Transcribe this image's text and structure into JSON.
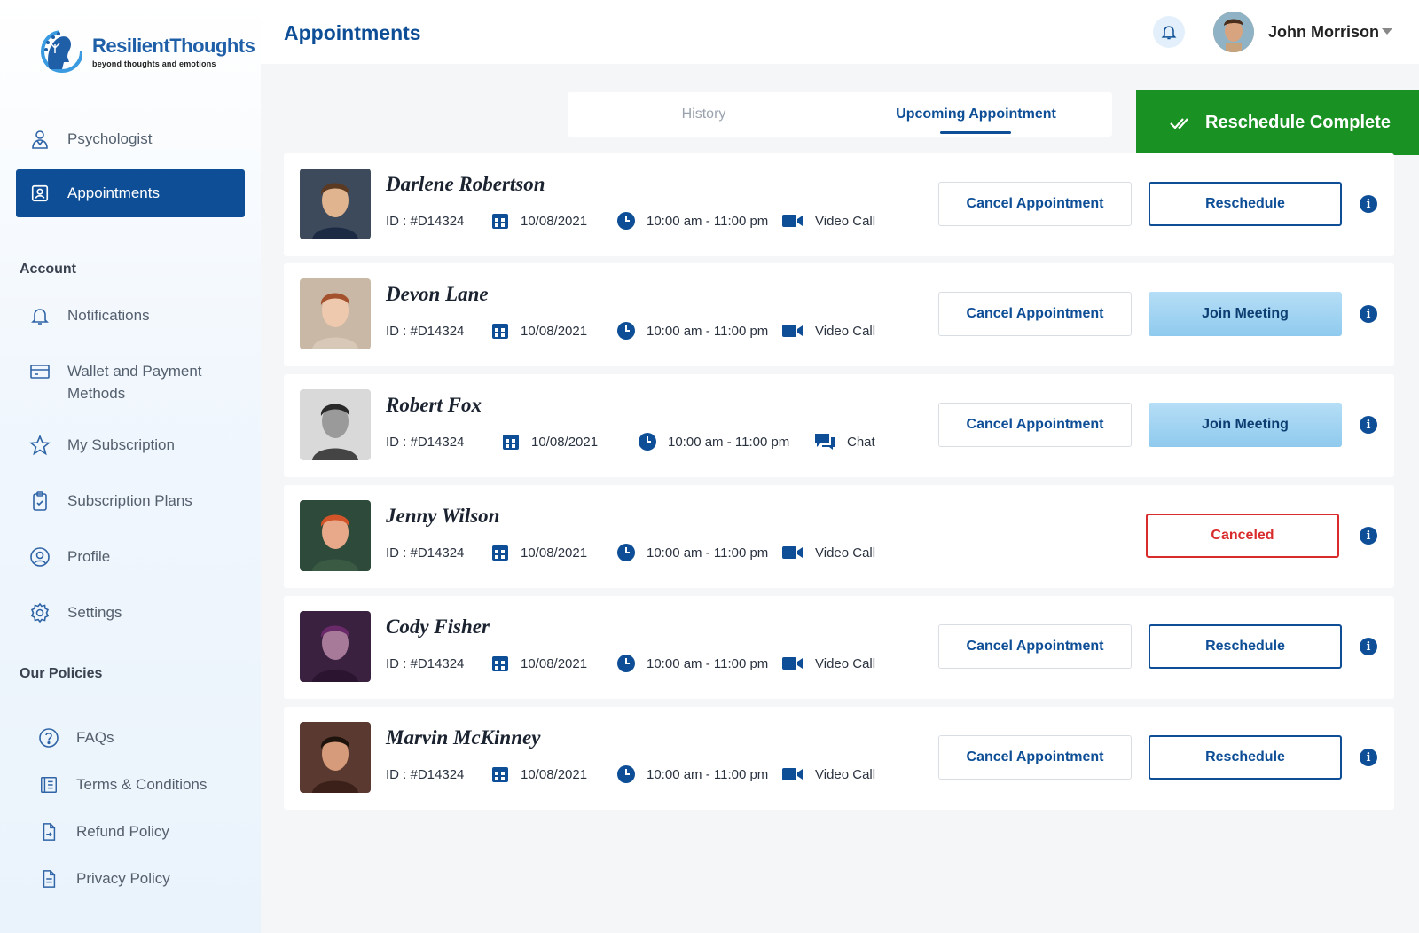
{
  "brand": {
    "name_part1": "Resilient",
    "name_part2": "Thoughts",
    "tagline": "beyond thoughts and emotions"
  },
  "sidebar": {
    "items": [
      {
        "label": "Psychologist",
        "icon": "psychologist-icon",
        "active": false
      },
      {
        "label": "Appointments",
        "icon": "appointments-icon",
        "active": true
      }
    ],
    "account_label": "Account",
    "account_items": [
      {
        "label": "Notifications",
        "icon": "bell-icon"
      },
      {
        "label": "Wallet and Payment Methods",
        "icon": "wallet-icon"
      },
      {
        "label": "My Subscription",
        "icon": "star-icon"
      },
      {
        "label": "Subscription Plans",
        "icon": "clipboard-icon"
      },
      {
        "label": "Profile",
        "icon": "profile-icon"
      },
      {
        "label": "Settings",
        "icon": "gear-icon"
      }
    ],
    "policies_label": "Our Policies",
    "policy_items": [
      {
        "label": "FAQs",
        "icon": "question-icon"
      },
      {
        "label": "Terms & Conditions",
        "icon": "document-icon"
      },
      {
        "label": "Refund Policy",
        "icon": "refund-icon"
      },
      {
        "label": "Privacy Policy",
        "icon": "file-icon"
      }
    ]
  },
  "header": {
    "title": "Appointments",
    "user_name": "John Morrison"
  },
  "tabs": [
    {
      "label": "History",
      "active": false
    },
    {
      "label": "Upcoming Appointment",
      "active": true
    }
  ],
  "toast": {
    "message": "Reschedule Complete",
    "color": "#1a9123"
  },
  "appointments": [
    {
      "name": "Darlene Robertson",
      "id": "ID : #D14324",
      "date": "10/08/2021",
      "time": "10:00 am - 11:00 pm",
      "mode": "Video Call",
      "cancel_label": "Cancel Appointment",
      "action_label": "Reschedule",
      "action_type": "reschedule"
    },
    {
      "name": "Devon Lane",
      "id": "ID : #D14324",
      "date": "10/08/2021",
      "time": "10:00 am - 11:00 pm",
      "mode": "Video Call",
      "cancel_label": "Cancel Appointment",
      "action_label": "Join Meeting",
      "action_type": "join"
    },
    {
      "name": "Robert Fox",
      "id": "ID : #D14324",
      "date": "10/08/2021",
      "time": "10:00 am - 11:00 pm",
      "mode": "Chat",
      "cancel_label": "Cancel Appointment",
      "action_label": "Join Meeting",
      "action_type": "join"
    },
    {
      "name": "Jenny Wilson",
      "id": "ID : #D14324",
      "date": "10/08/2021",
      "time": "10:00 am - 11:00 pm",
      "mode": "Video Call",
      "cancel_label": "",
      "action_label": "Canceled",
      "action_type": "canceled"
    },
    {
      "name": "Cody Fisher",
      "id": "ID : #D14324",
      "date": "10/08/2021",
      "time": "10:00 am - 11:00 pm",
      "mode": "Video Call",
      "cancel_label": "Cancel Appointment",
      "action_label": "Reschedule",
      "action_type": "reschedule"
    },
    {
      "name": "Marvin McKinney",
      "id": "ID : #D14324",
      "date": "10/08/2021",
      "time": "10:00 am - 11:00 pm",
      "mode": "Video Call",
      "cancel_label": "Cancel Appointment",
      "action_label": "Reschedule",
      "action_type": "reschedule"
    }
  ],
  "colors": {
    "primary": "#0d4e96",
    "success": "#1a9123",
    "danger": "#d92b2b",
    "join": "#8fcaee"
  }
}
